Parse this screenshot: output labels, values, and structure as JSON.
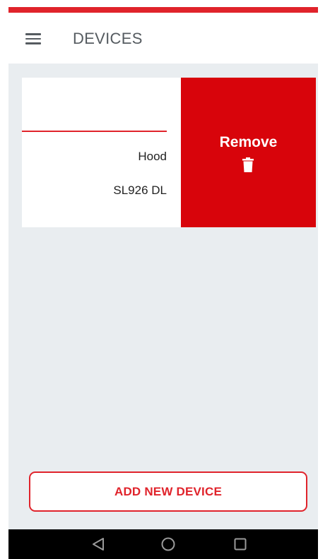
{
  "header": {
    "title": "DEVICES",
    "menu_icon": "hamburger-menu-icon"
  },
  "colors": {
    "accent": "#e0232b",
    "remove_background": "#d8040b",
    "content_background": "#e9edf0",
    "nav_bar": "#000000"
  },
  "devices": [
    {
      "name": "Hood",
      "model": "SL926 DL",
      "swipe_action": {
        "label": "Remove",
        "icon": "trash-icon"
      }
    }
  ],
  "footer": {
    "add_button_label": "ADD NEW DEVICE"
  },
  "system_nav": {
    "icons": [
      "back-icon",
      "home-icon",
      "recents-icon"
    ]
  }
}
